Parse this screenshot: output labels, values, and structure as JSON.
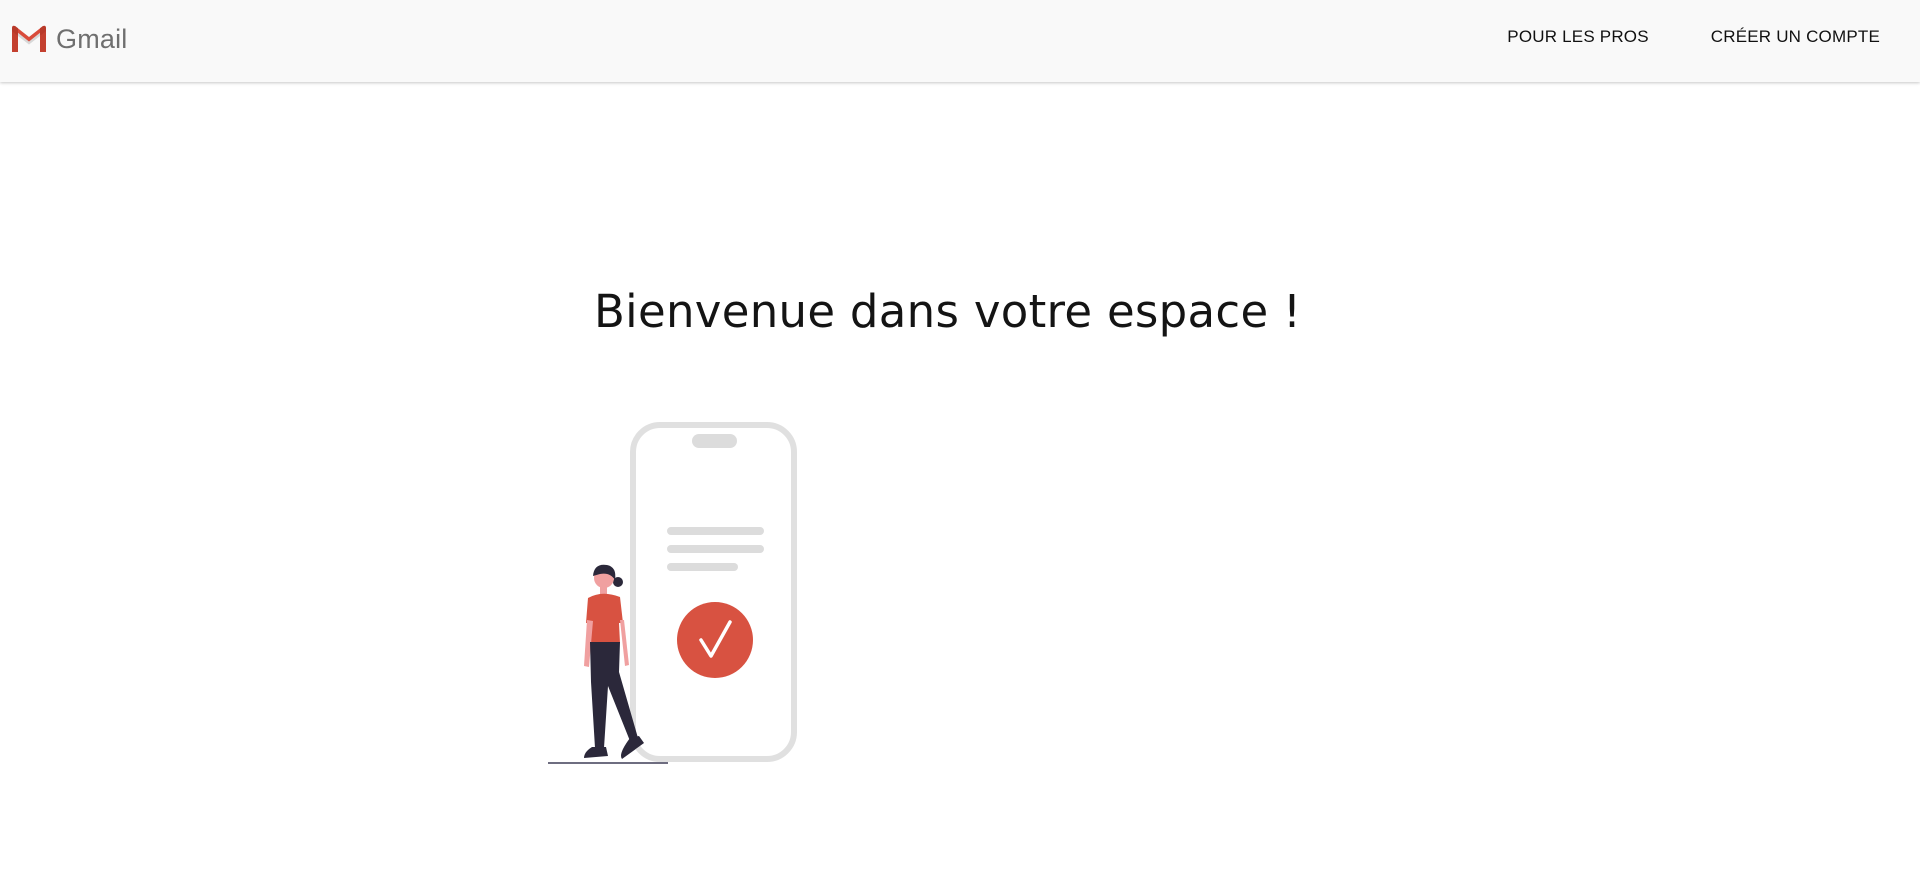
{
  "header": {
    "brand": "Gmail",
    "logo_icon": "gmail-m-icon",
    "nav": [
      {
        "label": "POUR LES PROS"
      },
      {
        "label": "CRÉER UN COMPTE"
      }
    ]
  },
  "main": {
    "welcome_title": "Bienvenue dans votre espace !",
    "illustration": {
      "icon": "phone-checkmark-illustration",
      "check_icon": "checkmark-icon"
    }
  },
  "colors": {
    "accent": "#d85241",
    "topbar_bg": "#f9f9f9",
    "phone_frame": "#e0e0e0",
    "figure_dark": "#2b283a"
  }
}
